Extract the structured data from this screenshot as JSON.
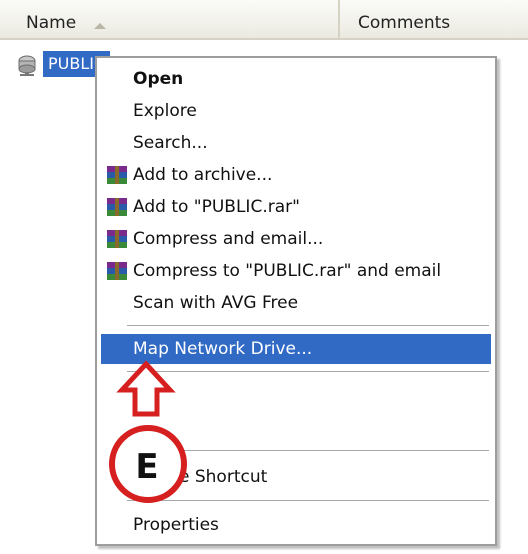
{
  "columns": {
    "name": "Name",
    "comments": "Comments"
  },
  "file": {
    "label": "PUBLIC"
  },
  "menu": {
    "items": [
      {
        "label": "Open",
        "bold": true
      },
      {
        "label": "Explore"
      },
      {
        "label": "Search..."
      },
      {
        "label": "Add to archive...",
        "icon": "rar-archive-icon"
      },
      {
        "label": "Add to \"PUBLIC.rar\"",
        "icon": "rar-archive-icon"
      },
      {
        "label": "Compress and email...",
        "icon": "rar-archive-icon"
      },
      {
        "label": "Compress to \"PUBLIC.rar\" and email",
        "icon": "rar-archive-icon"
      },
      {
        "label": "Scan with AVG Free"
      },
      {
        "label": "Map Network Drive...",
        "highlighted": true
      },
      {
        "label": "e Shortcut"
      },
      {
        "label": "Properties"
      }
    ]
  },
  "callout": {
    "letter": "E",
    "color": "#d62020"
  },
  "colors": {
    "selection": "#316ac5",
    "menu_border": "#9d9d9d",
    "header_bg": "#ebeae1"
  }
}
